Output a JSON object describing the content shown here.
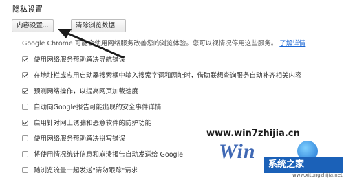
{
  "section": {
    "title": "隐私设置"
  },
  "buttons": {
    "content_settings": "内容设置...",
    "clear_data": "清除浏览数据..."
  },
  "description": {
    "text": "Google Chrome 可能会使用网络服务改善您的浏览体验。您可以视情况停用这些服务。",
    "link": "了解详情"
  },
  "options": [
    {
      "label": "使用网络服务帮助解决导航错误",
      "checked": true
    },
    {
      "label": "在地址栏或应用启动器搜索框中输入搜索字词和网址时，借助联想查询服务自动补齐相关内容",
      "checked": true
    },
    {
      "label": "预测网络操作，以提高网页加载速度",
      "checked": true
    },
    {
      "label": "自动向Google报告可能出现的安全事件详情",
      "checked": false
    },
    {
      "label": "启用针对网上诱骗和恶意软件的防护功能",
      "checked": true
    },
    {
      "label": "使用网络服务帮助解决拼写错误",
      "checked": false
    },
    {
      "label": "将使用情况统计信息和崩溃报告自动发送给 Google",
      "checked": false
    },
    {
      "label": "随浏览流量一起发送\"请勿跟踪\"请求",
      "checked": false
    }
  ],
  "watermark": {
    "text": "www.win7zhijia.cn",
    "logo_text": "Win",
    "site_name": "系统之家",
    "site_url": "www.xitongzhijia.net"
  },
  "colors": {
    "link": "#1a66d4",
    "logo_blue": "#1b61b8"
  }
}
